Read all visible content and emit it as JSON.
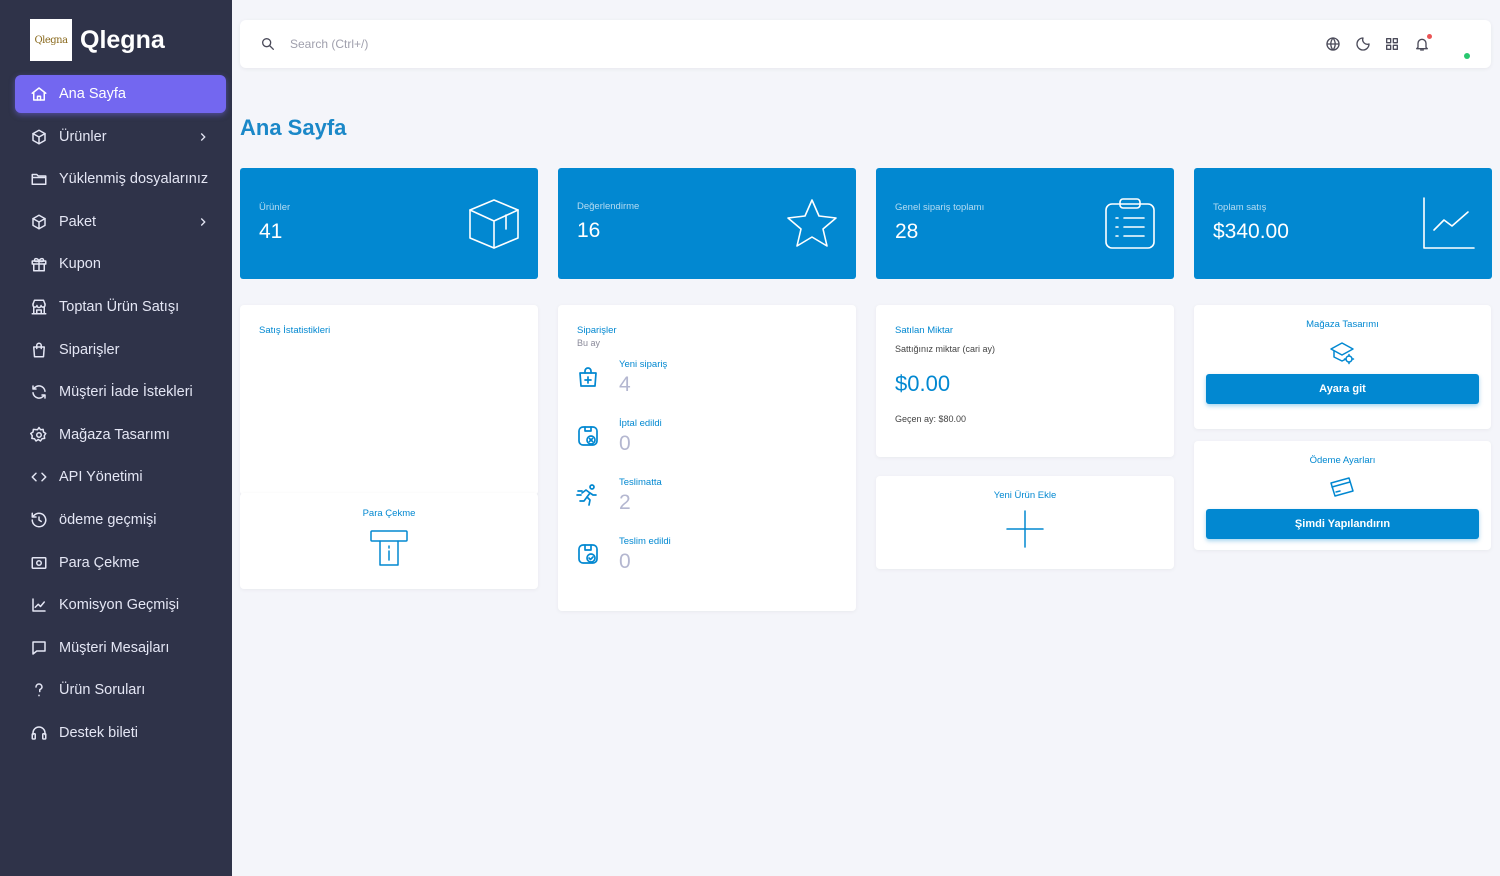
{
  "brand": {
    "logo_text": "Qlegna",
    "name": "Qlegna"
  },
  "sidebar": {
    "items": [
      {
        "label": "Ana Sayfa",
        "icon": "home-icon",
        "active": true
      },
      {
        "label": "Ürünler",
        "icon": "box-icon",
        "has_submenu": true
      },
      {
        "label": "Yüklenmiş dosyalarınız",
        "icon": "folder-icon"
      },
      {
        "label": "Paket",
        "icon": "box-icon",
        "has_submenu": true
      },
      {
        "label": "Kupon",
        "icon": "gift-icon"
      },
      {
        "label": "Toptan Ürün Satışı",
        "icon": "building-store-icon"
      },
      {
        "label": "Siparişler",
        "icon": "shopping-bag-icon"
      },
      {
        "label": "Müşteri İade İstekleri",
        "icon": "refresh-icon"
      },
      {
        "label": "Mağaza Tasarımı",
        "icon": "settings-icon"
      },
      {
        "label": "API Yönetimi",
        "icon": "code-icon"
      },
      {
        "label": "ödeme geçmişi",
        "icon": "history-icon"
      },
      {
        "label": "Para Çekme",
        "icon": "cash-icon"
      },
      {
        "label": "Komisyon Geçmişi",
        "icon": "chart-line-icon"
      },
      {
        "label": "Müşteri Mesajları",
        "icon": "message-icon"
      },
      {
        "label": "Ürün Soruları",
        "icon": "question-icon"
      },
      {
        "label": "Destek bileti",
        "icon": "headset-icon"
      }
    ]
  },
  "topbar": {
    "search_placeholder": "Search (Ctrl+/)",
    "icons": [
      "language-icon",
      "moon-icon",
      "apps-grid-icon",
      "bell-icon"
    ]
  },
  "page_title": "Ana Sayfa",
  "stats": [
    {
      "label": "Ürünler",
      "value": "41",
      "icon": "box-icon"
    },
    {
      "label": "Değerlendirme",
      "value": "16",
      "icon": "star-icon"
    },
    {
      "label": "Genel sipariş toplamı",
      "value": "28",
      "icon": "clipboard-list-icon"
    },
    {
      "label": "Toplam satış",
      "value": "$340.00",
      "icon": "chart-line-icon"
    }
  ],
  "sales_stats": {
    "title": "Satış İstatistikleri"
  },
  "withdraw": {
    "title": "Para Çekme",
    "icon": "atm-withdraw-icon"
  },
  "orders": {
    "title": "Siparişler",
    "subtitle": "Bu ay",
    "rows": [
      {
        "label": "Yeni sipariş",
        "value": "4",
        "icon": "bag-plus-icon"
      },
      {
        "label": "İptal edildi",
        "value": "0",
        "icon": "cancel-icon"
      },
      {
        "label": "Teslimatta",
        "value": "2",
        "icon": "running-icon"
      },
      {
        "label": "Teslim edildi",
        "value": "0",
        "icon": "package-check-icon"
      }
    ]
  },
  "sold_amount": {
    "title": "Satılan Miktar",
    "subtitle": "Sattığınız miktar (cari ay)",
    "value": "$0.00",
    "last_month": "Geçen ay: $80.00"
  },
  "new_product": {
    "title": "Yeni Ürün Ekle",
    "icon": "plus-icon"
  },
  "store_design": {
    "title": "Mağaza Tasarımı",
    "button": "Ayara git",
    "icon": "store-settings-icon"
  },
  "payment_settings": {
    "title": "Ödeme Ayarları",
    "button": "Şimdi Yapılandırın",
    "icon": "credit-card-icon"
  },
  "colors": {
    "sidebar_bg": "#2f3349",
    "active_item": "#7367f0",
    "primary": "#0288d1",
    "page_bg": "#f4f5fa"
  }
}
